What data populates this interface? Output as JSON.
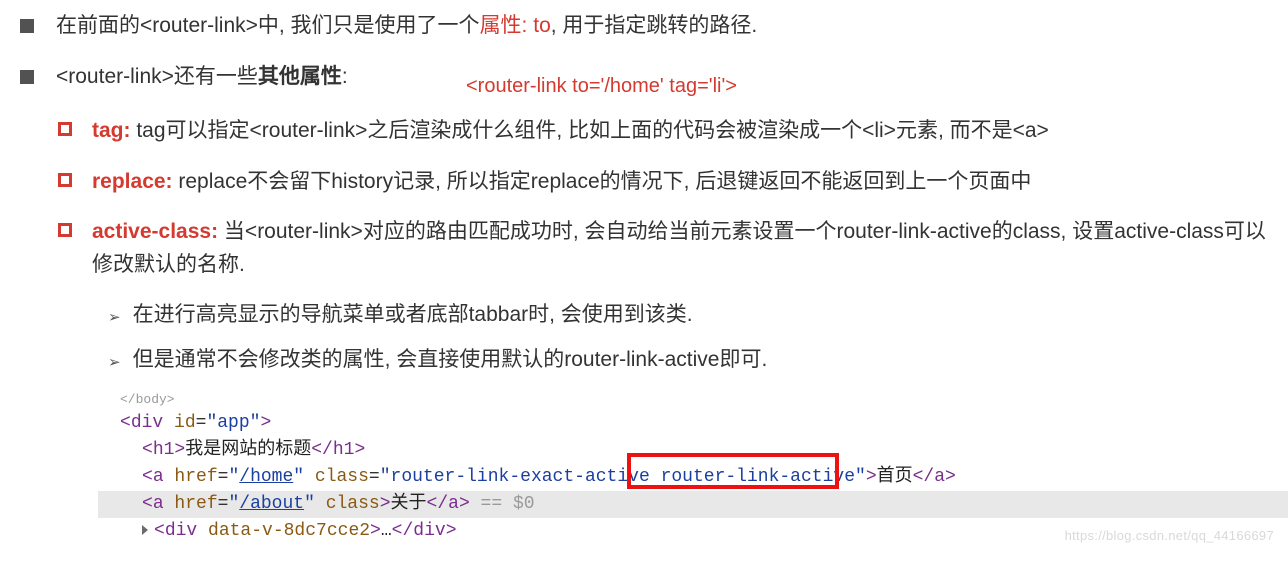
{
  "bullets": {
    "b1_pre": "在前面的<router-link>中, 我们只是使用了一个",
    "b1_red": "属性: to",
    "b1_post": ", 用于指定跳转的路径.",
    "b2_pre": "<router-link>还有一些",
    "b2_bold": "其他属性",
    "b2_post": ":",
    "annot": "<router-link to='/home' tag='li'>",
    "tag_label": "tag:",
    "tag_text": " tag可以指定<router-link>之后渲染成什么组件, 比如上面的代码会被渲染成一个<li>元素, 而不是<a>",
    "replace_label": "replace:",
    "replace_text": " replace不会留下history记录, 所以指定replace的情况下, 后退键返回不能返回到上一个页面中",
    "active_label": "active-class:",
    "active_text_1": " 当<router-link>对应的路由匹配成功时, 会自动给当前元素设置一个router-link-active的class, 设置active-class可以修改默认的名称.",
    "sub1": "在进行高亮显示的导航菜单或者底部tabbar时, 会使用到该类.",
    "sub2": "但是通常不会修改类的属性, 会直接使用默认的router-link-active即可."
  },
  "code": {
    "close_body": "</body>",
    "div_open_1": "<",
    "div_open_tag": "div",
    "div_open_attr": " id",
    "div_open_eq": "=",
    "div_open_val": "\"app\"",
    "div_open_2": ">",
    "h1_open": "<",
    "h1_tag": "h1",
    "h1_open2": ">",
    "h1_text": "我是网站的标题",
    "h1_close1": "</",
    "h1_close2": ">",
    "a1_open": "<",
    "a_tag": "a",
    "a_href": " href",
    "a_eq": "=",
    "a1_q": "\"",
    "a1_link": "/home",
    "a_class": " class",
    "a1_classval": "\"router-link-exact-active router-link-active\"",
    "a1_close": ">",
    "a1_text": "首页",
    "a_close1": "</",
    "a_close2": ">",
    "a2_q": "\"",
    "a2_link": "/about",
    "a2_classonly": " class",
    "a2_close": ">",
    "a2_text": "关于",
    "eq0": " == $0",
    "inner_div_open": "<",
    "inner_div_tag": "div",
    "inner_div_attr": " data-v-8dc7cce2",
    "inner_div_close": ">",
    "inner_div_dots": "…",
    "inner_div_end1": "</",
    "inner_div_end2": ">"
  },
  "watermark": "https://blog.csdn.net/qq_44166697"
}
